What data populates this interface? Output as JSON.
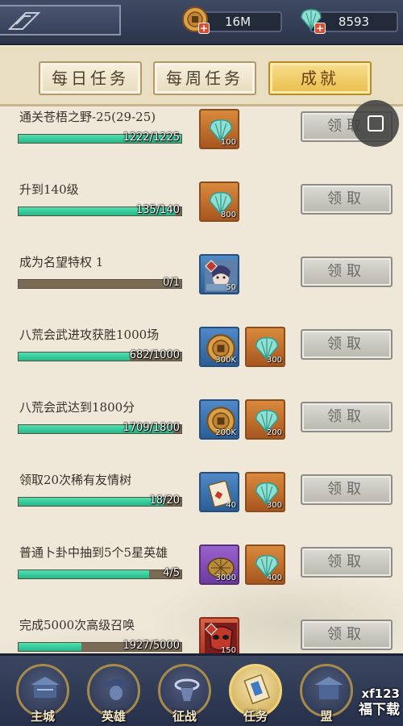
{
  "currency": {
    "gold": {
      "value": "16M",
      "icon": "coin-icon"
    },
    "shell": {
      "value": "8593",
      "icon": "shell-icon"
    }
  },
  "tabs": [
    {
      "label": "每日任务",
      "active": false
    },
    {
      "label": "每周任务",
      "active": false
    },
    {
      "label": "成就",
      "active": true
    }
  ],
  "tasks": [
    {
      "title": "通关苍梧之野-25(29-25)",
      "progress": "1222/1225",
      "fraction": 0.9976,
      "rewards": [
        {
          "icon": "shell-icon",
          "qty": "100",
          "frame": "orange"
        }
      ],
      "claim": "领取"
    },
    {
      "title": "升到140级",
      "progress": "135/140",
      "fraction": 0.964,
      "rewards": [
        {
          "icon": "shell-icon",
          "qty": "800",
          "frame": "orange"
        }
      ],
      "claim": "领取"
    },
    {
      "title": "成为名望特权 1",
      "progress": "0/1",
      "fraction": 0,
      "rewards": [
        {
          "icon": "hero-portrait-icon",
          "qty": "50",
          "frame": "blue"
        }
      ],
      "claim": "领取"
    },
    {
      "title": "八荒会武进攻获胜1000场",
      "progress": "682/1000",
      "fraction": 0.682,
      "rewards": [
        {
          "icon": "coin-icon",
          "qty": "300K",
          "frame": "blue"
        },
        {
          "icon": "shell-icon",
          "qty": "300",
          "frame": "orange"
        }
      ],
      "claim": "领取"
    },
    {
      "title": "八荒会武达到1800分",
      "progress": "1709/1800",
      "fraction": 0.949,
      "rewards": [
        {
          "icon": "coin-icon",
          "qty": "200K",
          "frame": "blue"
        },
        {
          "icon": "shell-icon",
          "qty": "200",
          "frame": "orange"
        }
      ],
      "claim": "领取"
    },
    {
      "title": "领取20次稀有友情树",
      "progress": "18/20",
      "fraction": 0.9,
      "rewards": [
        {
          "icon": "card-icon",
          "qty": "40",
          "frame": "blue"
        },
        {
          "icon": "shell-icon",
          "qty": "300",
          "frame": "orange"
        }
      ],
      "claim": "领取"
    },
    {
      "title": "普通卜卦中抽到5个5星英雄",
      "progress": "4/5",
      "fraction": 0.8,
      "rewards": [
        {
          "icon": "turtle-shell-icon",
          "qty": "3000",
          "frame": "purple"
        },
        {
          "icon": "shell-icon",
          "qty": "400",
          "frame": "orange"
        }
      ],
      "claim": "领取"
    },
    {
      "title": "完成5000次高级召唤",
      "progress": "1927/5000",
      "fraction": 0.385,
      "rewards": [
        {
          "icon": "mask-hero-icon",
          "qty": "150",
          "frame": "red"
        }
      ],
      "claim": "领取"
    }
  ],
  "nav": [
    {
      "label": "主城",
      "icon": "city-icon",
      "active": false
    },
    {
      "label": "英雄",
      "icon": "hero-icon",
      "active": false
    },
    {
      "label": "征战",
      "icon": "battle-icon",
      "active": false
    },
    {
      "label": "任务",
      "icon": "scroll-icon",
      "active": true
    },
    {
      "label": "盟",
      "icon": "alliance-icon",
      "active": false
    }
  ],
  "watermark": {
    "line1": "xf123",
    "line2": "福下载"
  },
  "colors": {
    "progress": "#2fc897",
    "tab_active": "#f2cf6a",
    "nav_bg": "#2f3a54"
  }
}
